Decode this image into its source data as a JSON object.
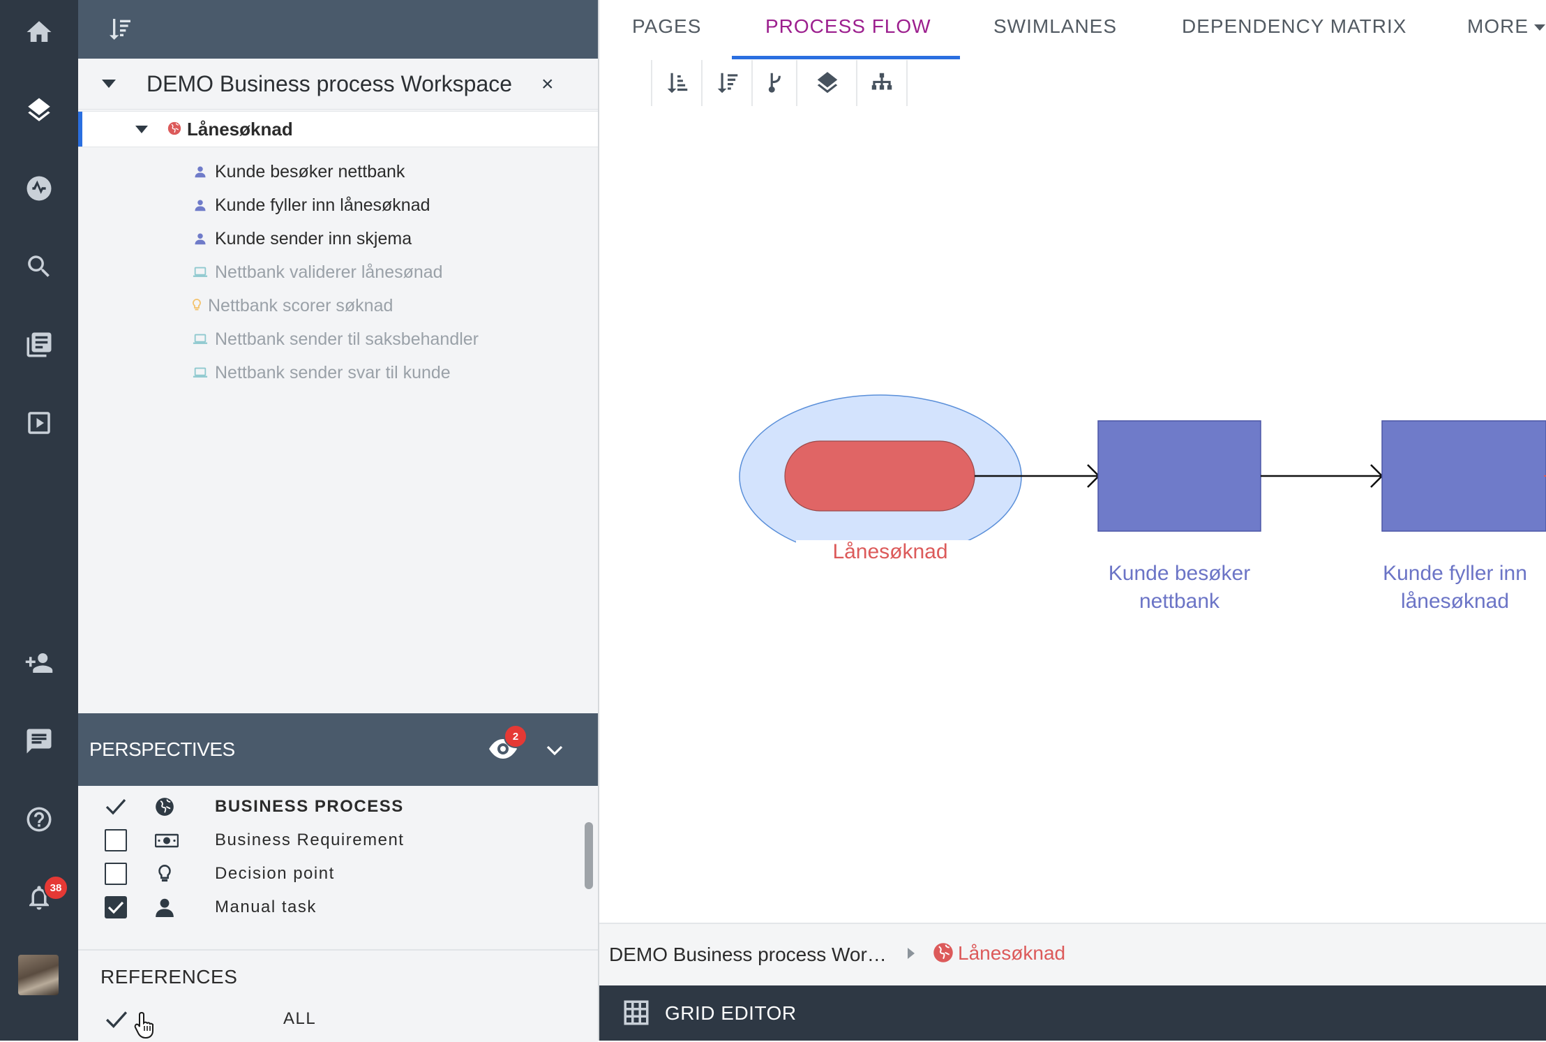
{
  "rail": {
    "items": [
      {
        "name": "home",
        "icon": "home-icon"
      },
      {
        "name": "layers",
        "icon": "layers-icon"
      },
      {
        "name": "activity",
        "icon": "activity-icon"
      },
      {
        "name": "search",
        "icon": "search-icon"
      },
      {
        "name": "library",
        "icon": "library-icon"
      },
      {
        "name": "play",
        "icon": "play-icon"
      },
      {
        "name": "add-user",
        "icon": "add-user-icon"
      },
      {
        "name": "chat",
        "icon": "chat-icon"
      },
      {
        "name": "help",
        "icon": "help-icon"
      },
      {
        "name": "notifications",
        "icon": "bell-icon"
      }
    ],
    "notification_count": "38"
  },
  "tree": {
    "workspace_title": "DEMO Business process Workspace",
    "close_label": "×",
    "process": {
      "label": "Lånesøknad",
      "color": "#dc5a5a"
    },
    "items": [
      {
        "label": "Kunde besøker nettbank",
        "type": "manual",
        "muted": false
      },
      {
        "label": "Kunde fyller inn lånesøknad",
        "type": "manual",
        "muted": false
      },
      {
        "label": "Kunde sender inn skjema",
        "type": "manual",
        "muted": false
      },
      {
        "label": "Nettbank validerer lånesønad",
        "type": "system",
        "muted": true
      },
      {
        "label": "Nettbank scorer søknad",
        "type": "decision",
        "muted": true
      },
      {
        "label": "Nettbank sender til saksbehandler",
        "type": "system",
        "muted": true
      },
      {
        "label": "Nettbank sender svar til kunde",
        "type": "system",
        "muted": true
      }
    ]
  },
  "perspectives": {
    "title": "PERSPECTIVES",
    "badge": "2",
    "items": [
      {
        "label": "BUSINESS PROCESS",
        "state": "check",
        "icon": "globe-icon",
        "bold": true
      },
      {
        "label": "Business Requirement",
        "state": "unchecked",
        "icon": "money-icon",
        "bold": false
      },
      {
        "label": "Decision point",
        "state": "unchecked",
        "icon": "bulb-icon",
        "bold": false
      },
      {
        "label": "Manual task",
        "state": "checked",
        "icon": "person-icon",
        "bold": false
      }
    ]
  },
  "references": {
    "title": "REFERENCES",
    "all_label": "ALL"
  },
  "tabs": {
    "items": [
      "PAGES",
      "PROCESS FLOW",
      "SWIMLANES",
      "DEPENDENCY MATRIX",
      "MORE"
    ],
    "active": "PROCESS FLOW"
  },
  "toolbar": {
    "tools": [
      "sort-ascending-icon",
      "sort-descending-icon",
      "branch-icon",
      "layers-icon",
      "hierarchy-icon"
    ]
  },
  "diagram": {
    "process_node": {
      "label": "Lånesøknad",
      "fill": "#e06565",
      "halo": "#d3e3fd"
    },
    "task_nodes": [
      {
        "label_line1": "Kunde besøker",
        "label_line2": "nettbank",
        "fill": "#6f7bc9"
      },
      {
        "label_line1": "Kunde fyller inn",
        "label_line2": "lånesøknad",
        "fill": "#6f7bc9"
      }
    ]
  },
  "breadcrumb": {
    "root": "DEMO Business process Wor…",
    "current": "Lånesøknad"
  },
  "grid_editor": {
    "label": "GRID EDITOR"
  },
  "colors": {
    "rail": "#2e3844",
    "panel_header": "#4a5a6b",
    "accent_blue": "#2a6fe0",
    "active_tab": "#9c1f8e",
    "process_red": "#dc5a5a",
    "task_blue": "#6f7bc9"
  }
}
